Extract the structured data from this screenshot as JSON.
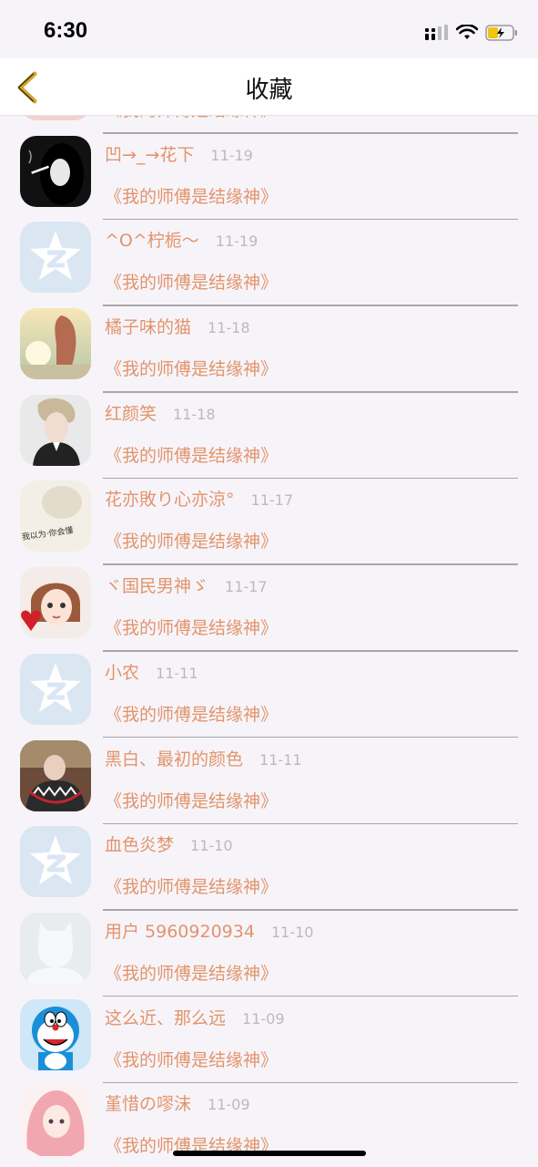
{
  "status": {
    "time": "6:30"
  },
  "nav": {
    "title": "收藏"
  },
  "colors": {
    "accent": "#e2946c",
    "back_arrow": "#d4a72a",
    "divider": "#a8a6ab",
    "date": "#bdb8bd"
  },
  "rows": [
    {
      "name": "",
      "date": "",
      "book": "《我的师傅是结缘神》",
      "avatar": "pink-illustration"
    },
    {
      "name": "凹→_→花下",
      "date": "11-19",
      "book": "《我的师傅是结缘神》",
      "avatar": "bw-smoker-photo"
    },
    {
      "name": "^O^柠栀～",
      "date": "11-19",
      "book": "《我的师傅是结缘神》",
      "avatar": "qq-default-icon"
    },
    {
      "name": "橘子味的猫",
      "date": "11-18",
      "book": "《我的师傅是结缘神》",
      "avatar": "sunset-girl-photo"
    },
    {
      "name": "红颜笑",
      "date": "11-18",
      "book": "《我的师傅是结缘神》",
      "avatar": "man-portrait-photo"
    },
    {
      "name": "花亦敗り心亦涼°",
      "date": "11-17",
      "book": "《我的师傅是结缘神》",
      "avatar": "sketch-text-image"
    },
    {
      "name": "ヾ国民男神ゞ",
      "date": "11-17",
      "book": "《我的师傅是结缘神》",
      "avatar": "girl-heart-photo"
    },
    {
      "name": "小农",
      "date": "11-11",
      "book": "《我的师傅是结缘神》",
      "avatar": "qq-default-icon"
    },
    {
      "name": "黑白、最初的颜色",
      "date": "11-11",
      "book": "《我的师傅是结缘神》",
      "avatar": "shark-hoodie-photo"
    },
    {
      "name": "血色炎梦",
      "date": "11-10",
      "book": "《我的师傅是结缘神》",
      "avatar": "qq-default-icon"
    },
    {
      "name": "用户 5960920934",
      "date": "11-10",
      "book": "《我的师傅是结缘神》",
      "avatar": "default-user-silhouette"
    },
    {
      "name": "这么近、那么远",
      "date": "11-09",
      "book": "《我的师傅是结缘神》",
      "avatar": "doraemon-image"
    },
    {
      "name": "堇惜の嘐沫",
      "date": "11-09",
      "book": "《我的师傅是结缘神》",
      "avatar": "pink-hair-anime"
    }
  ]
}
